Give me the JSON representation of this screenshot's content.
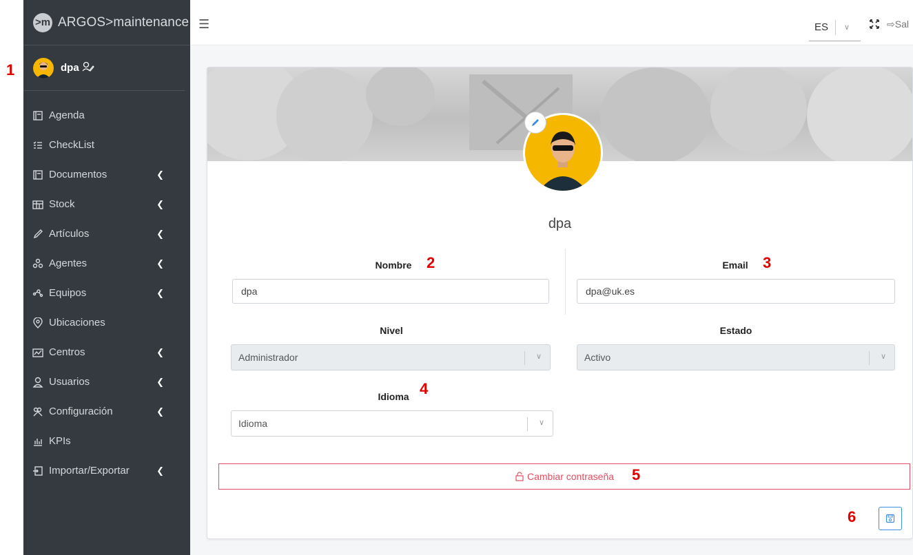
{
  "annotations": [
    "1",
    "2",
    "3",
    "4",
    "5",
    "6"
  ],
  "app": {
    "logo_text": ">m",
    "title": "ARGOS>maintenance"
  },
  "user": {
    "name": "dpa"
  },
  "sidebar": {
    "items": [
      {
        "label": "Agenda",
        "icon": "calendar-icon",
        "has_submenu": false
      },
      {
        "label": "CheckList",
        "icon": "checklist-icon",
        "has_submenu": false
      },
      {
        "label": "Documentos",
        "icon": "document-icon",
        "has_submenu": true
      },
      {
        "label": "Stock",
        "icon": "stock-icon",
        "has_submenu": true
      },
      {
        "label": "Artículos",
        "icon": "pencil-icon",
        "has_submenu": true
      },
      {
        "label": "Agentes",
        "icon": "agents-icon",
        "has_submenu": true
      },
      {
        "label": "Equipos",
        "icon": "equipment-icon",
        "has_submenu": true
      },
      {
        "label": "Ubicaciones",
        "icon": "location-icon",
        "has_submenu": false
      },
      {
        "label": "Centros",
        "icon": "centers-icon",
        "has_submenu": true
      },
      {
        "label": "Usuarios",
        "icon": "user-icon",
        "has_submenu": true
      },
      {
        "label": "Configuración",
        "icon": "tools-icon",
        "has_submenu": true
      },
      {
        "label": "KPIs",
        "icon": "chart-icon",
        "has_submenu": false
      },
      {
        "label": "Importar/Exportar",
        "icon": "import-icon",
        "has_submenu": true
      }
    ]
  },
  "header": {
    "language": "ES",
    "exit_label": "Sal"
  },
  "profile": {
    "name": "dpa",
    "nombre_label": "Nombre",
    "nombre_value": "dpa",
    "email_label": "Email",
    "email_value": "dpa@uk.es",
    "nivel_label": "Nivel",
    "nivel_value": "Administrador",
    "estado_label": "Estado",
    "estado_value": "Activo",
    "idioma_label": "Idioma",
    "idioma_placeholder": "Idioma",
    "change_password_label": "Cambiar contraseña"
  },
  "colors": {
    "sidebar_bg": "#343a40",
    "accent_red": "#e24d5f",
    "avatar_yellow": "#f5b700",
    "primary_blue": "#3b8de0",
    "annotation_red": "#e00000"
  }
}
